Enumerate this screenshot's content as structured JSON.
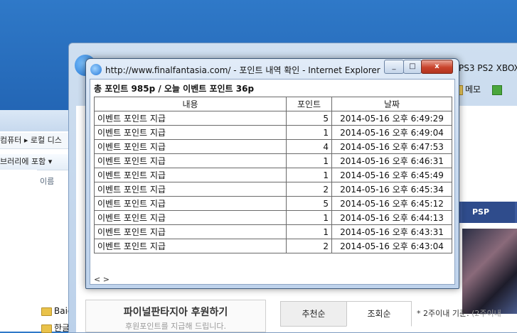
{
  "explorer": {
    "breadcrumb": "컴퓨터 ▸ 로컬 디스",
    "toolbar_label": "브러리에 포함 ▾",
    "column_name": "이름",
    "files": [
      "Baid",
      "한글"
    ]
  },
  "ie_main": {
    "tabs_right": "PS3 PS2 XBOX",
    "memo_label": "메모",
    "nav_tab_psp": "PSP",
    "sponsor_title": "파이널판타지아 후원하기",
    "sponsor_sub": "후원포인트를 지급해 드립니다.",
    "sort_tabs": [
      "추천순",
      "조회순"
    ],
    "sort_note_main": "* 2주이내 기준.",
    "sort_note_grey": "(2주이내"
  },
  "popup": {
    "title": "http://www.finalfantasia.com/ - 포인트 내역 확인 - Internet Explorer",
    "summary": "총 포인트 985p / 오늘 이벤트 포인트 36p",
    "headers": [
      "내용",
      "포인트",
      "날짜"
    ],
    "rows": [
      {
        "content": "이벤트 포인트 지급",
        "points": "5",
        "date": "2014-05-16 오후 6:49:29"
      },
      {
        "content": "이벤트 포인트 지급",
        "points": "1",
        "date": "2014-05-16 오후 6:49:04"
      },
      {
        "content": "이벤트 포인트 지급",
        "points": "4",
        "date": "2014-05-16 오후 6:47:53"
      },
      {
        "content": "이벤트 포인트 지급",
        "points": "1",
        "date": "2014-05-16 오후 6:46:31"
      },
      {
        "content": "이벤트 포인트 지급",
        "points": "1",
        "date": "2014-05-16 오후 6:45:49"
      },
      {
        "content": "이벤트 포인트 지급",
        "points": "2",
        "date": "2014-05-16 오후 6:45:34"
      },
      {
        "content": "이벤트 포인트 지급",
        "points": "5",
        "date": "2014-05-16 오후 6:45:12"
      },
      {
        "content": "이벤트 포인트 지급",
        "points": "1",
        "date": "2014-05-16 오후 6:44:13"
      },
      {
        "content": "이벤트 포인트 지급",
        "points": "1",
        "date": "2014-05-16 오후 6:43:31"
      },
      {
        "content": "이벤트 포인트 지급",
        "points": "2",
        "date": "2014-05-16 오후 6:43:04"
      }
    ],
    "scroll_hint": "< >",
    "buttons": {
      "minimize": "_",
      "maximize": "□",
      "close": "x"
    }
  },
  "colors": {
    "desktop": "#2a6fc2",
    "nav_bar": "#3c5a9e",
    "close_button": "#c9432c"
  }
}
